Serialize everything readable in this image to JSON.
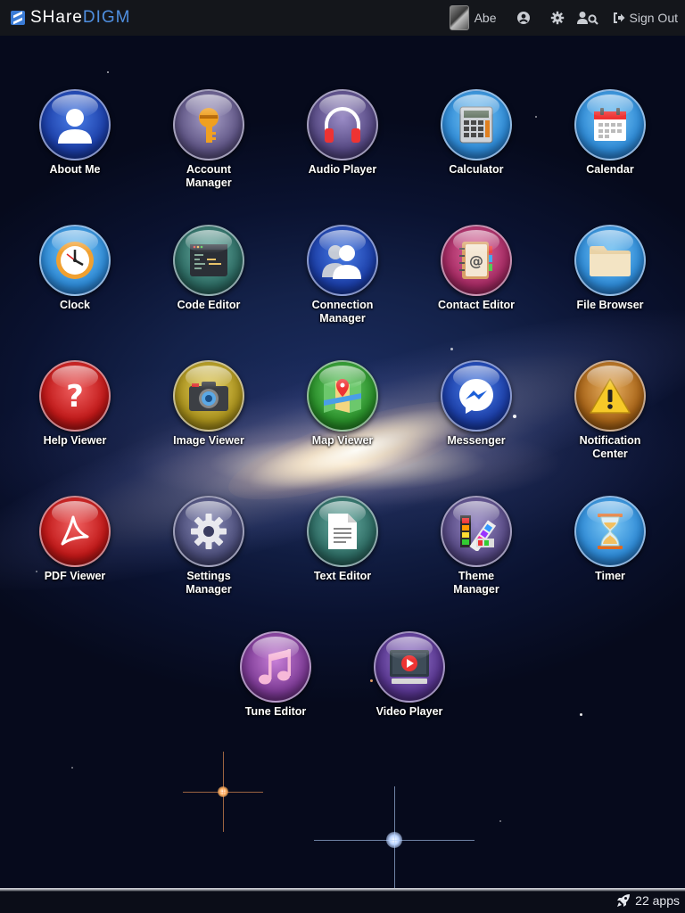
{
  "brand": {
    "part1": "SHare",
    "part2": "DIGM"
  },
  "user": {
    "name": "Abe"
  },
  "header": {
    "signout_label": "Sign Out"
  },
  "apps": [
    {
      "label": "About Me"
    },
    {
      "label": "Account\nManager"
    },
    {
      "label": "Audio Player"
    },
    {
      "label": "Calculator"
    },
    {
      "label": "Calendar"
    },
    {
      "label": "Clock"
    },
    {
      "label": "Code Editor"
    },
    {
      "label": "Connection\nManager"
    },
    {
      "label": "Contact Editor"
    },
    {
      "label": "File Browser"
    },
    {
      "label": "Help Viewer"
    },
    {
      "label": "Image Viewer"
    },
    {
      "label": "Map Viewer"
    },
    {
      "label": "Messenger"
    },
    {
      "label": "Notification\nCenter"
    },
    {
      "label": "PDF Viewer"
    },
    {
      "label": "Settings\nManager"
    },
    {
      "label": "Text Editor"
    },
    {
      "label": "Theme\nManager"
    },
    {
      "label": "Timer"
    },
    {
      "label": "Tune Editor"
    },
    {
      "label": "Video Player"
    }
  ],
  "footer": {
    "app_count": "22 apps"
  },
  "colors": {
    "accent": "#4f8fe0",
    "topbar": "#14161b"
  }
}
